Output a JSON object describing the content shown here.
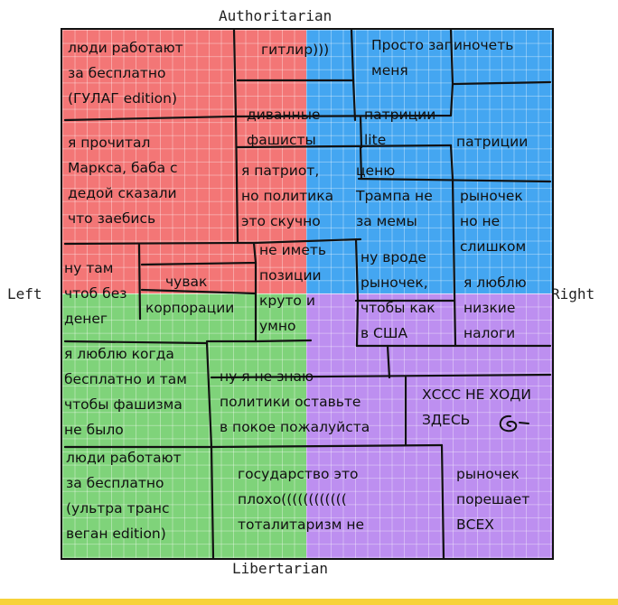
{
  "axes": {
    "top": "Authoritarian",
    "bottom": "Libertarian",
    "left": "Left",
    "right": "Right"
  },
  "cells": {
    "gulag": "люди работают\nза бесплатно\n(ГУЛАГ edition)",
    "hitler": "гитлир)))",
    "pin_me": "Просто запиночеть\nменя",
    "couch_fascists": "диванные\nфашисты",
    "patricians_lite": "патриции\nlite",
    "patricians": "патриции",
    "read_marx": "я прочитал\nМаркса, баба с\nдедой сказали\nчто заебись",
    "patriot": "я патриот,\nно политика\nэто скучно",
    "value_trump": "ценю\nТрампа не\nза мемы",
    "small_market": "рыночек\nно не\nслишком",
    "there_guy": "ну там\nчтоб без\nденег",
    "dude": "чувак",
    "no_position": "не иметь\nпозиции\nкруто и\nумно",
    "like_market": "ну вроде\nрыночек,\nчтобы как\nв США",
    "love_low_taxes": "я люблю\nнизкие\nналоги",
    "corporations": "корпорации",
    "free_no_fascists": "я люблю когда\nбесплатно и там\nчтобы фашизма\nне было",
    "dont_know": "ну я не знаю\nполитики оставьте\nв покое пожалуйста",
    "ccsc": "ХССС НЕ ХОДИ\nЗДЕСЬ",
    "vegan": "люди работают\nза бесплатно\n(ультра транс\nвеган edition)",
    "state_bad": "государство это\nплохо((((((((((((\nтоталитаризм не",
    "market_solves": "рыночек\nпорешает\nВСЕХ"
  },
  "colors": {
    "auth_left": "#f37676",
    "auth_right": "#44a6f1",
    "lib_left": "#7fd37a",
    "lib_right": "#bd8ff0",
    "footer": "#f7d23a"
  }
}
